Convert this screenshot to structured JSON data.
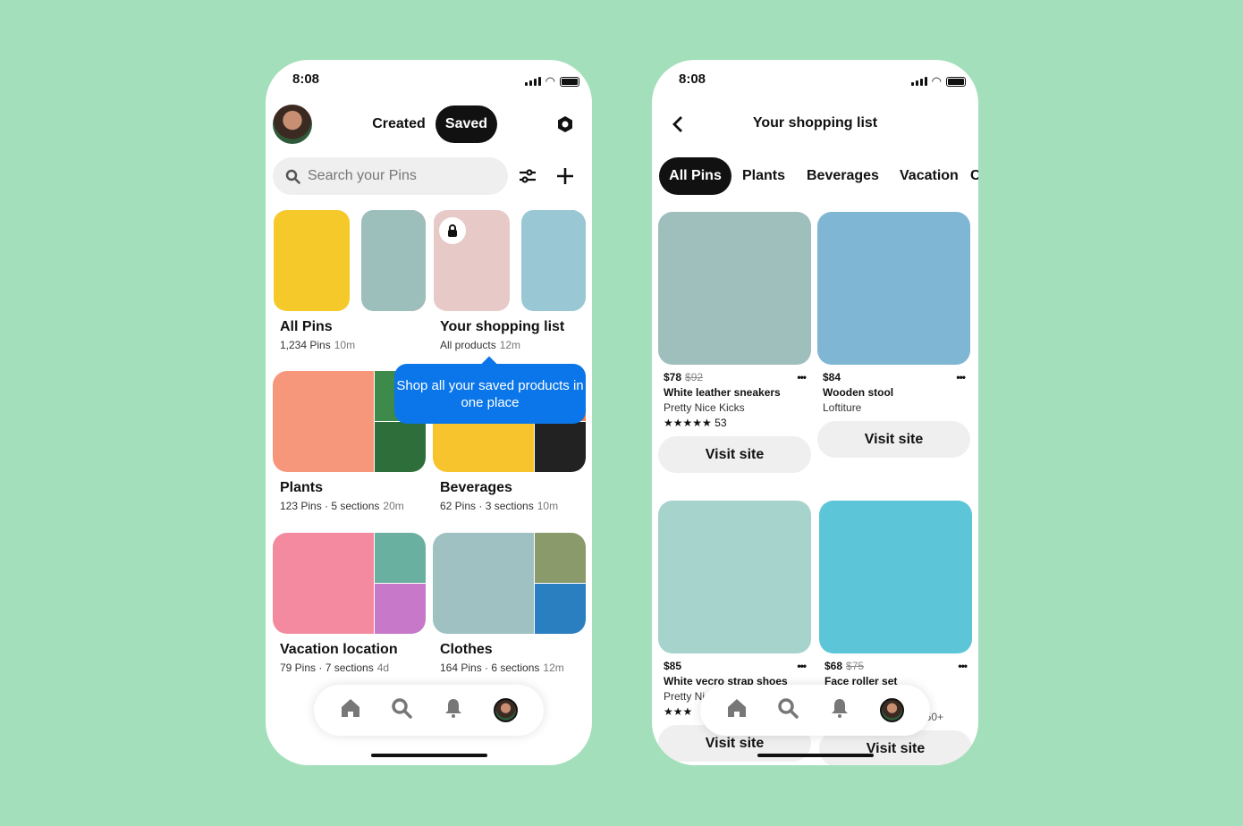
{
  "left": {
    "time": "8:08",
    "tabs": [
      {
        "label": "Created",
        "active": false
      },
      {
        "label": "Saved",
        "active": true
      }
    ],
    "search_placeholder": "Search your Pins",
    "boards": [
      {
        "title": "All Pins",
        "sub": "1,234 Pins",
        "age": "10m",
        "colors": [
          "#f5c92a",
          "#9dbfbb",
          "#f29a82",
          "#d9566a",
          "#3f7c4a"
        ]
      },
      {
        "title": "Your shopping list",
        "sub": "All products",
        "age": "12m",
        "colors": [
          "#e7c9c8",
          "#9ac7d4",
          "#8cc4d6",
          "#9fe0e3",
          "#3a6b4b"
        ],
        "locked": true
      },
      {
        "title": "Plants",
        "sub": "123 Pins · 5 sections",
        "age": "20m",
        "colors": [
          "#f6977c",
          "#3e8a4a",
          "#2e6e3a"
        ]
      },
      {
        "title": "Beverages",
        "sub": "62 Pins · 3 sections",
        "age": "10m",
        "colors": [
          "#f7c42e",
          "#f07a4a",
          "#222"
        ]
      },
      {
        "title": "Vacation location",
        "sub": "79 Pins · 7 sections",
        "age": "4d",
        "colors": [
          "#f48aa0",
          "#6ab0a0",
          "#c878c8"
        ]
      },
      {
        "title": "Clothes",
        "sub": "164 Pins · 6 sections",
        "age": "12m",
        "colors": [
          "#9fc1c2",
          "#8a9a6a",
          "#2a7fc0"
        ]
      }
    ],
    "tooltip": "Shop all your saved products in one place",
    "accent": "#0a76e9"
  },
  "right": {
    "time": "8:08",
    "title": "Your shopping list",
    "chips": [
      {
        "label": "All Pins",
        "active": true
      },
      {
        "label": "Plants"
      },
      {
        "label": "Beverages"
      },
      {
        "label": "Vacation"
      },
      {
        "label": "C"
      }
    ],
    "products": [
      {
        "price": "$78",
        "old": "$92",
        "title": "White leather sneakers",
        "brand": "Pretty Nice Kicks",
        "stars": "★★★★★",
        "count": "53",
        "color": "#9fbfbc",
        "visit": "Visit site"
      },
      {
        "price": "$84",
        "old": "",
        "title": "Wooden stool",
        "brand": "Loftiture",
        "stars": "",
        "count": "",
        "color": "#7fb6d3",
        "visit": "Visit site"
      },
      {
        "price": "$85",
        "old": "",
        "title": "White vecro strap shoes",
        "brand": "Pretty Ni",
        "stars": "★★★",
        "count": "",
        "color": "#a6d3cc",
        "visit": "Visit site"
      },
      {
        "price": "$68",
        "old": "$75",
        "title": "Face roller set",
        "brand": "",
        "stars": "",
        "count": "50+",
        "color": "#5cc6d8",
        "visit": "Visit site"
      }
    ]
  },
  "nav_icons": [
    "home-icon",
    "search-icon",
    "bell-icon",
    "profile-avatar"
  ]
}
